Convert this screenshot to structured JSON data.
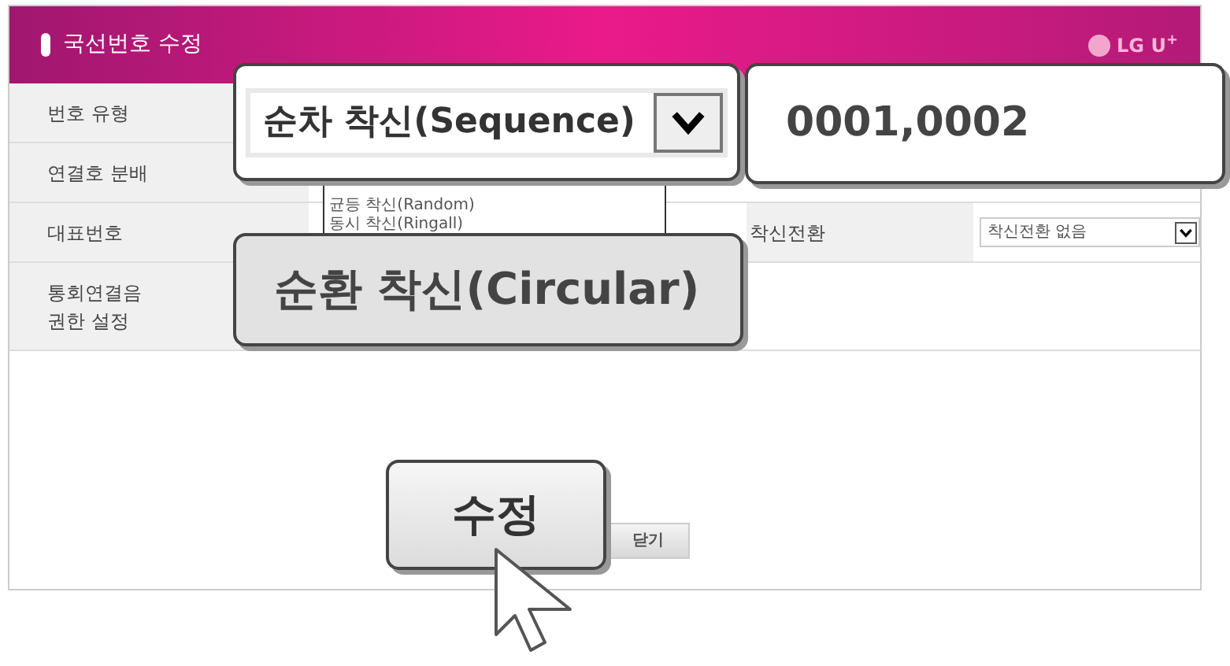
{
  "window": {
    "title": "국선번호 수정",
    "logo": "LG U$^{+}$"
  },
  "rows": [
    {
      "label": "번호 유형"
    },
    {
      "label": "연결호 분배"
    },
    {
      "label": "대표번호",
      "field_label": "착신전환",
      "select": "착신전환 없음"
    },
    {
      "label": "통회연결음\n권한 설정"
    }
  ],
  "dropdown_options": [
    "균등 착신(Random)",
    "동시 착신(Ringall)"
  ],
  "callouts": [
    {
      "kind": "select",
      "text": "순차 착신(Sequence)"
    },
    {
      "kind": "field",
      "text": "0001,0002"
    },
    {
      "kind": "option",
      "text": "순환 착신(Circular)"
    },
    {
      "kind": "button",
      "text": "수정"
    }
  ],
  "buttons": [
    "닫기"
  ]
}
